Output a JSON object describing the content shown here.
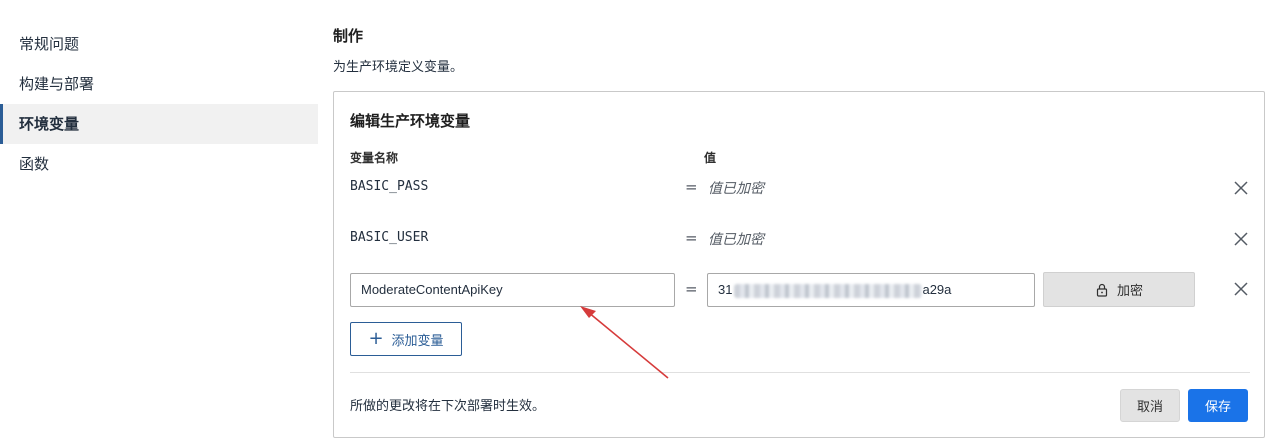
{
  "sidebar": {
    "items": [
      {
        "label": "常规问题",
        "active": false
      },
      {
        "label": "构建与部署",
        "active": false
      },
      {
        "label": "环境变量",
        "active": true
      },
      {
        "label": "函数",
        "active": false
      }
    ]
  },
  "main": {
    "title": "制作",
    "subtitle": "为生产环境定义变量。"
  },
  "panel": {
    "title": "编辑生产环境变量",
    "col_name": "变量名称",
    "col_value": "值",
    "rows": [
      {
        "key": "BASIC_PASS",
        "eq": "=",
        "value": "值已加密"
      },
      {
        "key": "BASIC_USER",
        "eq": "=",
        "value": "值已加密"
      }
    ],
    "edit_row": {
      "key_value": "ModerateContentApiKey",
      "eq": "=",
      "value_prefix": "31",
      "value_suffix": "a29a",
      "encrypt_label": "加密"
    },
    "add_label": "添加变量",
    "footer_note": "所做的更改将在下次部署时生效。",
    "cancel_label": "取消",
    "save_label": "保存"
  },
  "icons": {
    "close": "close-icon",
    "lock": "lock-icon",
    "plus": "plus-icon"
  },
  "colors": {
    "accent": "#2b5d96",
    "primary_button": "#1a73e8",
    "annotation_arrow": "#d63b3b"
  }
}
